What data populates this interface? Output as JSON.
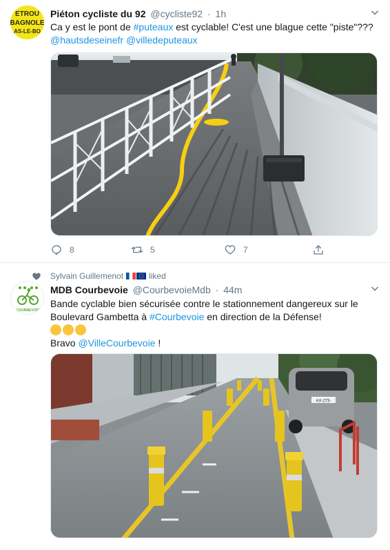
{
  "tweet1": {
    "display_name": "Piéton cycliste du 92",
    "handle": "@cycliste92",
    "separator": "·",
    "time": "1h",
    "text_1": "Ca y est le pont de ",
    "hashtag": "#puteaux",
    "text_2": " est cyclable! C'est une blague cette \"piste\"???",
    "mention_1": "@hautsdeseinefr",
    "mention_2": "@villedeputeaux",
    "avatar_text": [
      "ETROU",
      "BAGNOLE",
      "AS-LE-BO"
    ],
    "replies": "8",
    "retweets": "5",
    "likes": "7"
  },
  "tweet2": {
    "social_context_name": "Sylvain Guillemenot",
    "social_context_action": "liked",
    "display_name": "MDB Courbevoie",
    "handle": "@CourbevoieMdb",
    "separator": "·",
    "time": "44m",
    "text_1": "Bande cyclable bien sécurisée contre le stationnement dangereux sur le Boulevard Gambetta à ",
    "hashtag": "#Courbevoie",
    "text_2": " en direction de la Défense!",
    "text_3": "Bravo ",
    "mention": "@VilleCourbevoie",
    "text_4": " !",
    "avatar_text": "COURBEVOIE",
    "plate_text": "AX-273-"
  },
  "colors": {
    "link": "#1b95e0",
    "text": "#14171a",
    "muted": "#657786",
    "divider": "#e6ecf0",
    "avatar1_bg": "#f4e51a",
    "avatar2_green": "#5aa832"
  },
  "icons": {
    "caret": "chevron-down-icon",
    "reply": "reply-icon",
    "retweet": "retweet-icon",
    "like": "heart-icon",
    "share": "share-icon",
    "social_context": "heart-icon",
    "flags": [
      "france-flag-icon",
      "eu-flag-icon"
    ],
    "emoji": "clapping-hands-emoji"
  }
}
